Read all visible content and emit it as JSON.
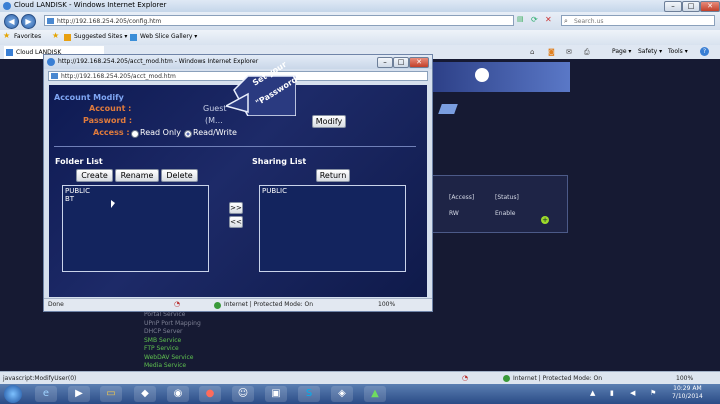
{
  "browser": {
    "title": "Cloud LANDISK - Windows Internet Explorer",
    "address": "http://192.168.254.205/config.htm",
    "search_placeholder": "Search.us",
    "favorites_label": "Favorites",
    "suggested_sites": "Suggested Sites ▾",
    "web_slice_gallery": "Web Slice Gallery ▾",
    "tab_label": "Cloud LANDISK",
    "page_menu": "Page ▾",
    "safety_menu": "Safety ▾",
    "tools_menu": "Tools ▾",
    "help_icon": "?",
    "status_url": "javascript:ModifyUser(0)",
    "status_zone": "Internet | Protected Mode: On",
    "status_zoom": "100%"
  },
  "background_page": {
    "col_access": "[Access]",
    "col_status": "[Status]",
    "row_access": "RW",
    "row_status": "Enable",
    "menu": [
      "Portal Service",
      "UPnP Port Mapping",
      "DHCP Server"
    ],
    "services": [
      "SMB Service",
      "FTP Service",
      "WebDAV Service",
      "Media Service"
    ]
  },
  "popup": {
    "title": "http://192.168.254.205/acct_mod.htm - Windows Internet Explorer",
    "address": "http://192.168.254.205/acct_mod.htm",
    "heading": "Account Modify",
    "account_label": "Account :",
    "account_value": "Guest",
    "password_label": "Password :",
    "password_hint": "(M...",
    "access_label": "Access :",
    "read_only": "Read Only",
    "read_write": "Read/Write",
    "modify_button": "Modify",
    "folder_list_title": "Folder List",
    "sharing_list_title": "Sharing List",
    "create_button": "Create",
    "rename_button": "Rename",
    "delete_button": "Delete",
    "return_button": "Return",
    "folder_items": [
      "PUBLIC",
      "BT"
    ],
    "sharing_items": [
      "PUBLIC"
    ],
    "add_button": ">>",
    "remove_button": "<<",
    "status_done": "Done",
    "status_zone": "Internet | Protected Mode: On",
    "status_zoom": "100%"
  },
  "callout": {
    "line1": "Set your",
    "line2": "\"Password\""
  },
  "taskbar": {
    "time": "10:29 AM",
    "date": "7/10/2014"
  }
}
